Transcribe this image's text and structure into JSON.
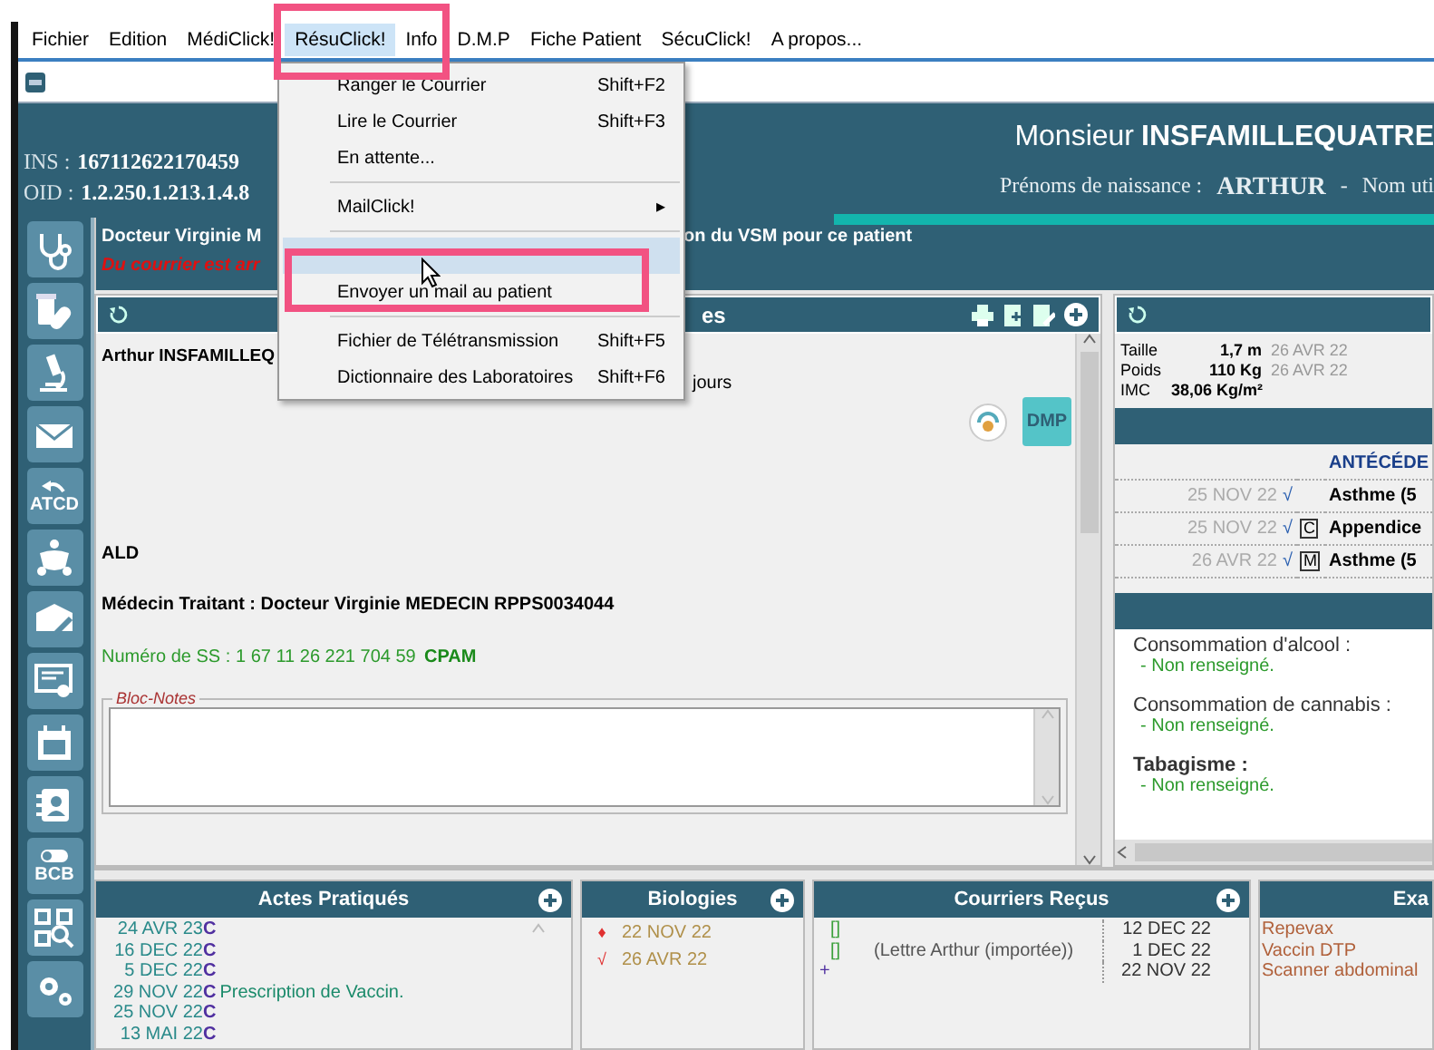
{
  "menu_bar": [
    {
      "label": "Fichier",
      "selected": false
    },
    {
      "label": "Edition",
      "selected": false
    },
    {
      "label": "MédiClick!",
      "selected": false
    },
    {
      "label": "RésuClick!",
      "selected": true
    },
    {
      "label": "Info",
      "selected": false
    },
    {
      "label": "D.M.P",
      "selected": false
    },
    {
      "label": "Fiche Patient",
      "selected": false
    },
    {
      "label": "SécuClick!",
      "selected": false
    },
    {
      "label": "A propos...",
      "selected": false
    }
  ],
  "dropdown": [
    {
      "kind": "item",
      "label": "Ranger le Courrier",
      "shortcut": "Shift+F2",
      "selected": false
    },
    {
      "kind": "item",
      "label": "Lire le Courrier",
      "shortcut": "Shift+F3",
      "selected": false
    },
    {
      "kind": "item",
      "label": "En attente...",
      "selected": false
    },
    {
      "kind": "separator"
    },
    {
      "kind": "submenu",
      "label": "MailClick!",
      "arrow": "▸",
      "selected": false
    },
    {
      "kind": "separator"
    },
    {
      "kind": "item",
      "selected": true
    },
    {
      "kind": "item",
      "label": "Envoyer un mail au patient",
      "selected": false
    },
    {
      "kind": "separator"
    },
    {
      "kind": "item",
      "label": "Fichier de Télétransmission",
      "shortcut": "Shift+F5",
      "selected": false
    },
    {
      "kind": "item",
      "label": "Dictionnaire des Laboratoires",
      "shortcut": "Shift+F6",
      "selected": false
    }
  ],
  "header": {
    "ins_label": "INS :",
    "ins": "167112622170459",
    "oid_label": "OID :",
    "oid": "1.2.250.1.213.1.4.8",
    "civility": "Monsieur",
    "surname": "INSFAMILLEQUATRE",
    "birth_names_label": "Prénoms de naissance :",
    "birth_names": "ARTHUR",
    "dash": "-",
    "used_name_label": "Nom uti"
  },
  "sidebar_labels": {
    "atcd": "ATCD",
    "bcb": "BCB"
  },
  "doctor_bar": {
    "doctor": "Docteur Virginie M",
    "notice": "on du VSM pour ce patient",
    "alert": "Du courrier est arr"
  },
  "patient_panel": {
    "title": "es",
    "patient_name": "Arthur INSFAMILLEQ",
    "duration": "jours",
    "dmp_button": "DMP",
    "ald": "ALD",
    "doctor_line": "Médecin Traitant : Docteur Virginie MEDECIN RPPS0034044",
    "ss_label": "Numéro de SS :",
    "ss_number": "1 67 11 26 221 704 59",
    "fund": "CPAM",
    "notes_legend": "Bloc-Notes"
  },
  "measures": [
    {
      "label": "Taille",
      "value": "1,7 m",
      "date": "26 AVR 22"
    },
    {
      "label": "Poids",
      "value": "110 Kg",
      "date": "26 AVR 22"
    },
    {
      "label": "IMC",
      "value": "38,06 Kg/m²"
    }
  ],
  "antecedents": {
    "title": "ANTÉCÉDE",
    "rows": [
      {
        "date": "25 NOV 22",
        "check": "√",
        "text": "Asthme (5"
      },
      {
        "date": "25 NOV 22",
        "check": "√",
        "tag": "C",
        "text": "Appendice"
      },
      {
        "date": "26 AVR 22",
        "check": "√",
        "tag": "M",
        "text": "Asthme (5"
      }
    ]
  },
  "habits": [
    {
      "label": "Consommation d'alcool :",
      "value": "- Non renseigné."
    },
    {
      "label": "Consommation de cannabis :",
      "value": "- Non renseigné."
    },
    {
      "label": "Tabagisme :",
      "value": "- Non renseigné."
    }
  ],
  "acts": {
    "title": "Actes Pratiqués",
    "rows": [
      {
        "date": "24 AVR 23",
        "code": "C"
      },
      {
        "date": "16 DEC 22",
        "code": "C"
      },
      {
        "date": "5 DEC 22",
        "code": "C"
      },
      {
        "date": "29 NOV 22",
        "code": "C",
        "text": "Prescription de Vaccin."
      },
      {
        "date": "25 NOV 22",
        "code": "C"
      },
      {
        "date": "13 MAI 22",
        "code": "C"
      }
    ]
  },
  "biologies": {
    "title": "Biologies",
    "rows": [
      {
        "mark": "♦",
        "date": "22 NOV 22"
      },
      {
        "mark": "√",
        "date": "26 AVR 22"
      }
    ]
  },
  "letters": {
    "title": "Courriers Reçus",
    "rows": [
      {
        "mark": "[]",
        "kind": "letter",
        "date": "12 DEC 22"
      },
      {
        "mark": "[]",
        "kind": "letter",
        "text": "(Lettre Arthur (importée))",
        "date": "1 DEC 22"
      },
      {
        "mark": "+",
        "kind": "plus",
        "date": "22 NOV 22"
      }
    ]
  },
  "exams": {
    "title": "Exa",
    "rows": [
      "Repevax",
      "Vaccin DTP",
      "Scanner abdominal"
    ]
  }
}
